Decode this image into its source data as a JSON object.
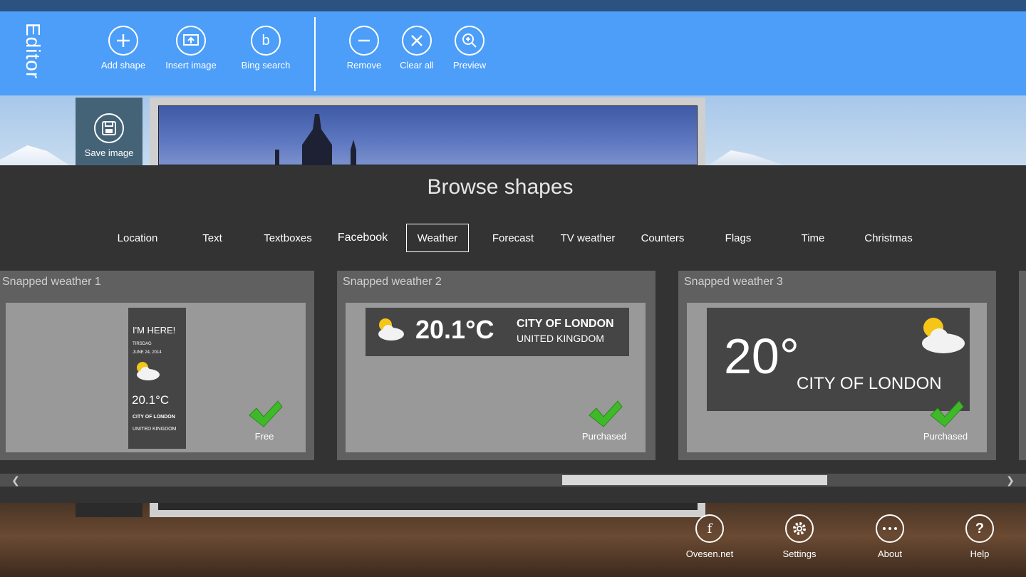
{
  "app": {
    "title": "Editor"
  },
  "toolbar": {
    "buttons": [
      {
        "label": "Add shape",
        "icon": "plus-icon"
      },
      {
        "label": "Insert image",
        "icon": "insert-image-icon"
      },
      {
        "label": "Bing search",
        "icon": "bing-icon",
        "glyph": "b"
      },
      {
        "label": "Remove",
        "icon": "minus-icon"
      },
      {
        "label": "Clear all",
        "icon": "close-icon"
      },
      {
        "label": "Preview",
        "icon": "zoom-icon"
      }
    ]
  },
  "save": {
    "label": "Save image",
    "icon": "save-icon"
  },
  "browse": {
    "title": "Browse shapes",
    "tabs": [
      {
        "label": "Location"
      },
      {
        "label": "Text"
      },
      {
        "label": "Textboxes"
      },
      {
        "label": "Facebook"
      },
      {
        "label": "Weather",
        "active": true
      },
      {
        "label": "Forecast"
      },
      {
        "label": "TV weather"
      },
      {
        "label": "Counters"
      },
      {
        "label": "Flags"
      },
      {
        "label": "Time"
      },
      {
        "label": "Christmas"
      }
    ],
    "cards": [
      {
        "title": "Snapped weather 1",
        "status": "Free",
        "widget": {
          "heading": "I'M HERE!",
          "day": "TIRSDAG",
          "date": "JUNE 24, 2014",
          "temp": "20.1°C",
          "city": "CITY OF LONDON",
          "country": "UNITED KINGDOM"
        }
      },
      {
        "title": "Snapped weather 2",
        "status": "Purchased",
        "widget": {
          "temp": "20.1°C",
          "city": "CITY OF LONDON",
          "country": "UNITED KINGDOM"
        }
      },
      {
        "title": "Snapped weather 3",
        "status": "Purchased",
        "widget": {
          "temp": "20°",
          "city": "CITY OF LONDON"
        }
      }
    ]
  },
  "scroll": {
    "position": 0.58
  },
  "bottombar": {
    "buttons": [
      {
        "label": "Ovesen.net",
        "icon": "facebook-icon",
        "glyph": "f"
      },
      {
        "label": "Settings",
        "icon": "gear-icon"
      },
      {
        "label": "About",
        "icon": "more-icon"
      },
      {
        "label": "Help",
        "icon": "help-icon",
        "glyph": "?"
      }
    ]
  },
  "colors": {
    "appbar": "#4c9ef8",
    "flyout": "#333333",
    "check": "#3fb92a"
  }
}
